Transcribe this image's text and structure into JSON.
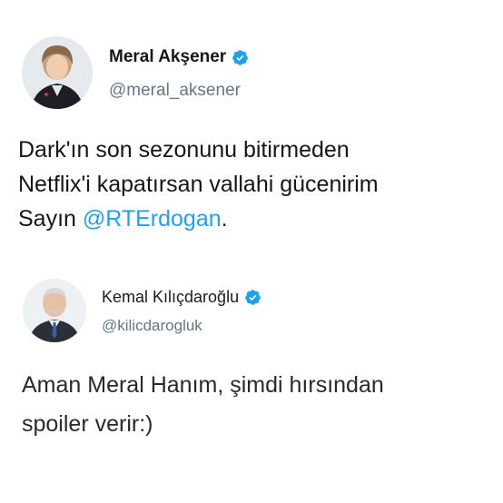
{
  "tweets": [
    {
      "author": {
        "display_name": "Meral Akşener",
        "handle": "@meral_aksener",
        "verified": true,
        "avatar_icon": "avatar-woman-photo"
      },
      "text_lines": [
        "Dark'ın son sezonunu bitirmeden",
        "Netflix'i kapatırsan vallahi gücenirim"
      ],
      "last_line_prefix": "Sayın ",
      "mention": "@RTErdogan",
      "last_line_suffix": "."
    },
    {
      "author": {
        "display_name": "Kemal Kılıçdaroğlu",
        "handle": "@kilicdarogluk",
        "verified": true,
        "avatar_icon": "avatar-man-photo"
      },
      "text_lines": [
        "Aman Meral Hanım, şimdi hırsından",
        "spoiler verir:)"
      ]
    }
  ],
  "colors": {
    "verified_badge": "#1da1f2",
    "mention": "#1da1f2",
    "handle": "#657786",
    "text": "#14171a"
  }
}
